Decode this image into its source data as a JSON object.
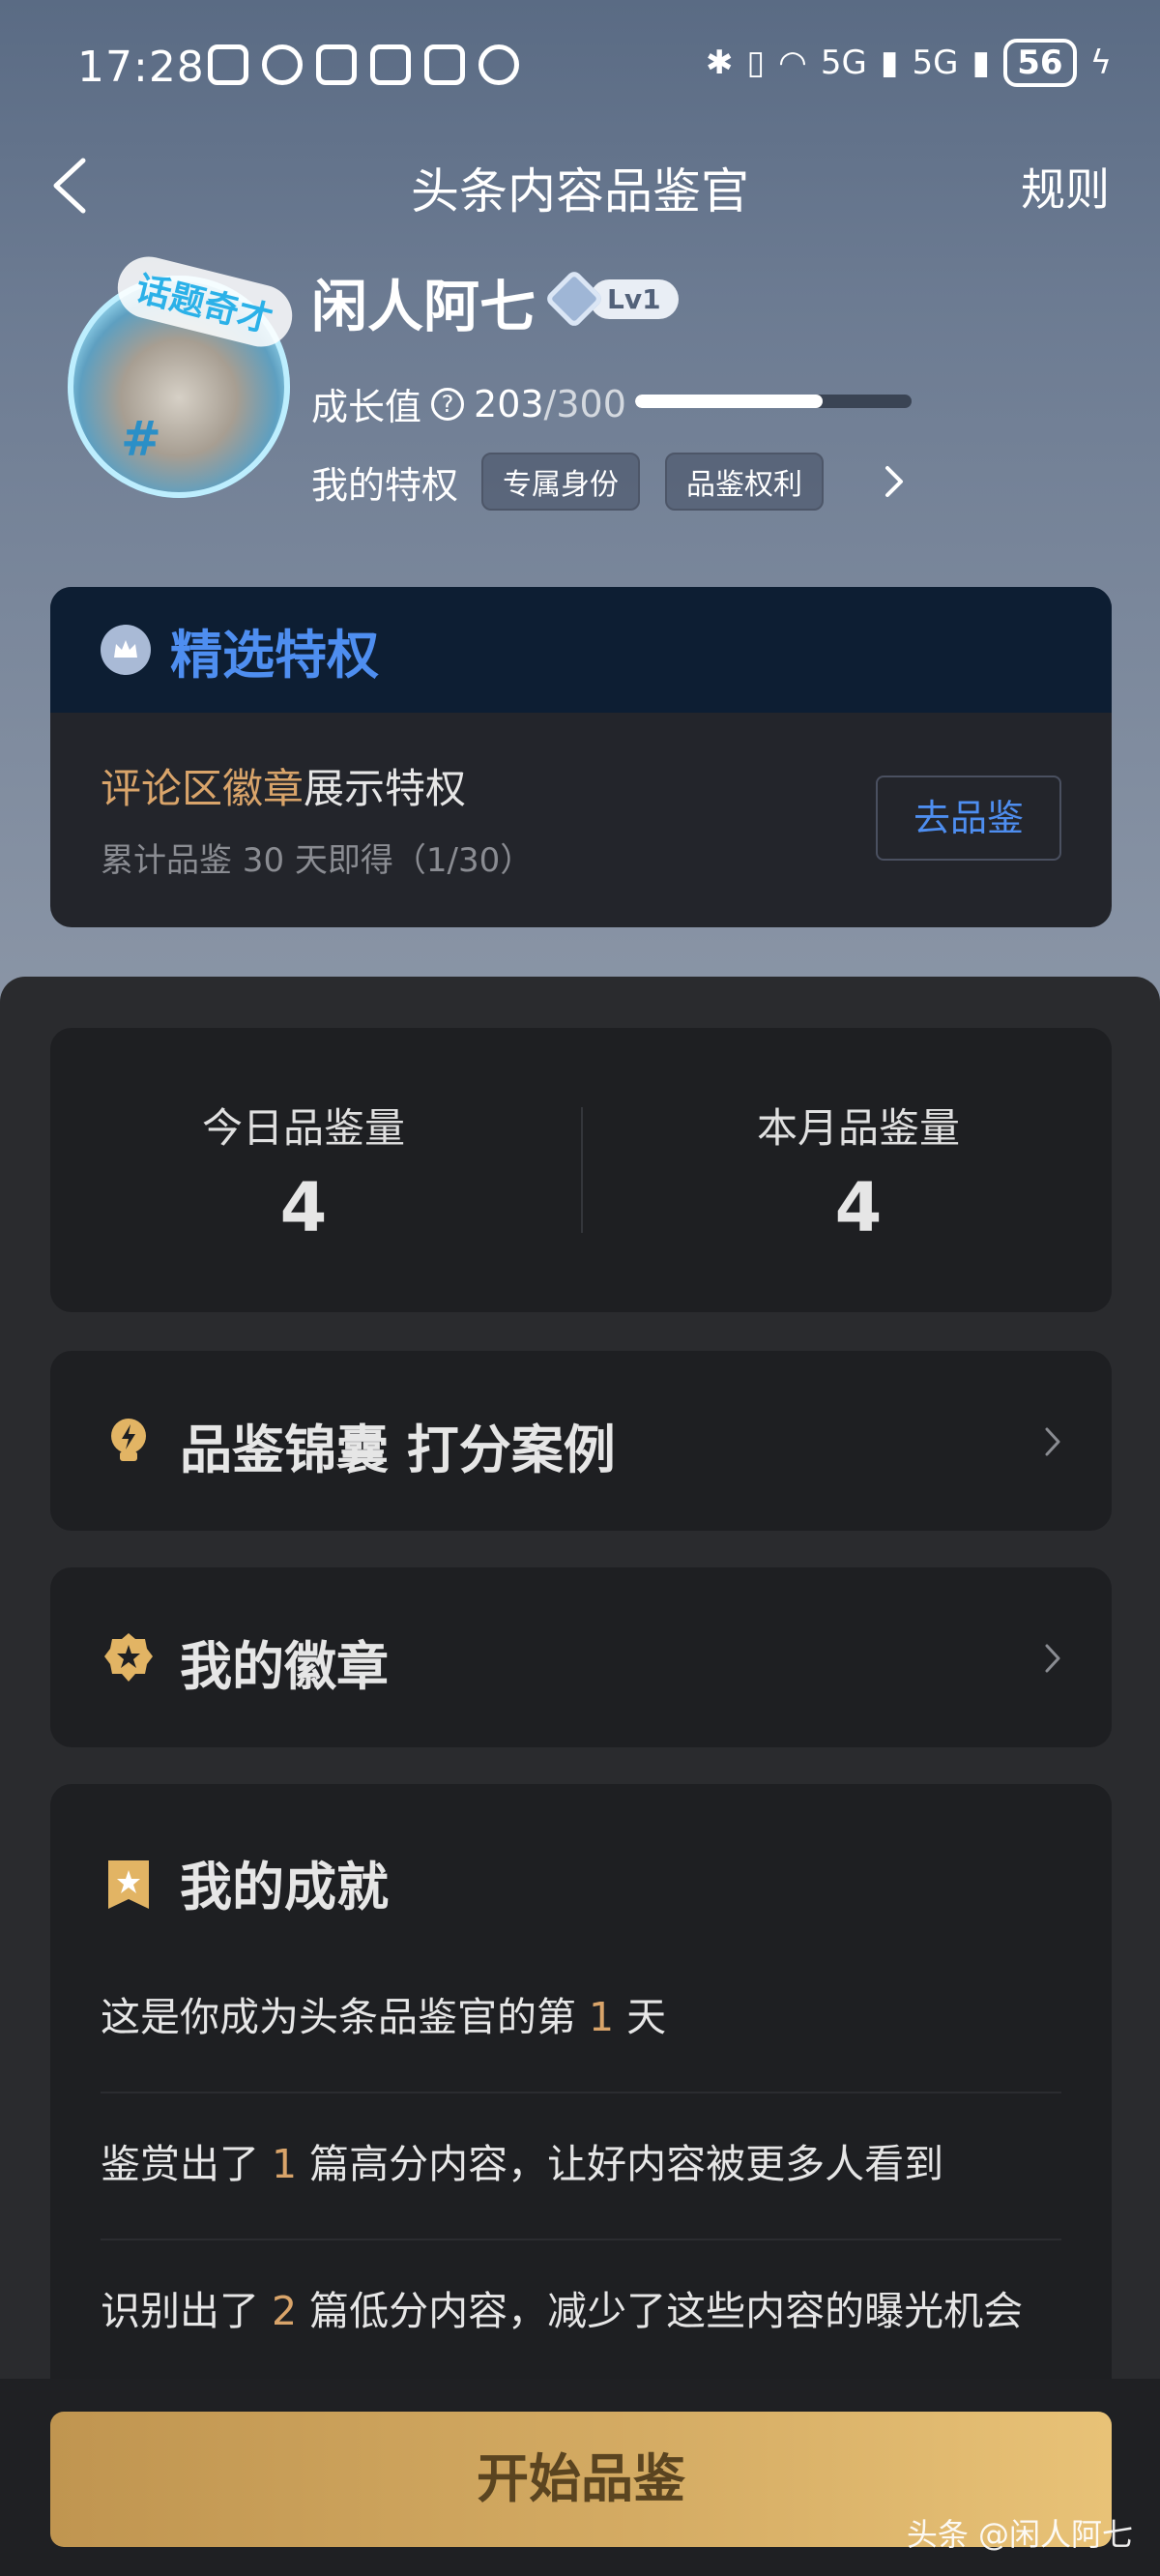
{
  "status_bar": {
    "time": "17:28",
    "net1": "5G",
    "net2": "5G",
    "battery": "56"
  },
  "header": {
    "title": "头条内容品鉴官",
    "rules": "规则"
  },
  "profile": {
    "avatar_ribbon": "话题奇才",
    "name": "闲人阿七",
    "level": "Lv1",
    "growth_label": "成长值",
    "growth_current": "203",
    "growth_max": "/300",
    "growth_progress": 0.677,
    "privileges_label": "我的特权",
    "tags": [
      "专属身份",
      "品鉴权利"
    ]
  },
  "privilege_card": {
    "title": "精选特权",
    "main_highlight": "评论区徽章",
    "main_rest": "展示特权",
    "subtitle": "累计品鉴 30 天即得（1/30）",
    "button": "去品鉴"
  },
  "stats": {
    "today_label": "今日品鉴量",
    "today_value": "4",
    "month_label": "本月品鉴量",
    "month_value": "4"
  },
  "tips_row": {
    "label": "品鉴锦囊 打分案例"
  },
  "badges_row": {
    "label": "我的徽章"
  },
  "achievements": {
    "title": "我的成就",
    "item1": {
      "pre": "这是你成为头条品鉴官的第 ",
      "num": "1",
      "post": " 天"
    },
    "item2": {
      "pre": "鉴赏出了 ",
      "num": "1",
      "post": " 篇高分内容，让好内容被更多人看到"
    },
    "item3": {
      "pre": "识别出了 ",
      "num": "2",
      "post": " 篇低分内容，减少了这些内容的曝光机会"
    }
  },
  "start_button": "开始品鉴",
  "watermark": "头条 @闲人阿七",
  "colors": {
    "accent_blue": "#4e8ef0",
    "gold": "#d9a46a",
    "button_gold": "#d4ab63"
  }
}
